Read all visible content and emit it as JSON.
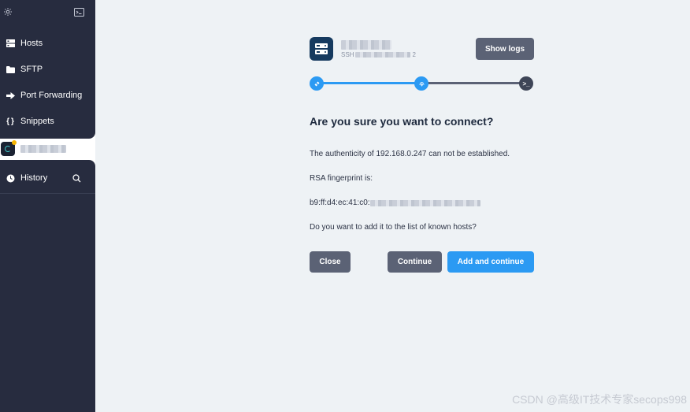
{
  "sidebar": {
    "nav": [
      {
        "label": "Hosts",
        "icon": "hosts-icon"
      },
      {
        "label": "SFTP",
        "icon": "folder-icon"
      },
      {
        "label": "Port Forwarding",
        "icon": "arrow-right-icon"
      },
      {
        "label": "Snippets",
        "icon": "braces-icon"
      }
    ],
    "history": {
      "label": "History"
    },
    "active_host": {
      "status_color": "#f5b400"
    }
  },
  "main": {
    "show_logs": "Show logs",
    "dialog": {
      "title": "Are you sure you want to connect?",
      "authenticity_line": "The authenticity of 192.168.0.247 can not be established.",
      "fingerprint_label": "RSA fingerprint is:",
      "fingerprint_prefix": "b9:ff:d4:ec:41:c0:",
      "question": "Do you want to add it to the list of known hosts?"
    },
    "host_sub_prefix": "SSH",
    "host_sub_suffix": "2",
    "buttons": {
      "close": "Close",
      "continue": "Continue",
      "add_continue": "Add and continue"
    },
    "progress": {
      "completed_steps": 2,
      "total_steps": 3
    },
    "colors": {
      "accent": "#2b9af3",
      "sidebar": "#272c3f",
      "button_dark": "#5b6275",
      "host_icon": "#163a5f"
    }
  },
  "watermark": "CSDN @高级IT技术专家secops998"
}
